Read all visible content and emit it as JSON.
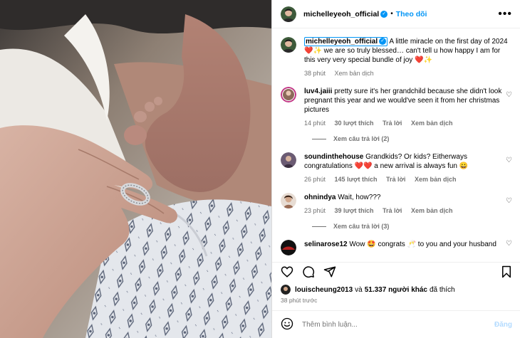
{
  "colors": {
    "accent": "#0095f6",
    "heart": "#ed4956",
    "muted": "#737373"
  },
  "header": {
    "username": "michelleyeoh_official",
    "follow_label": "Theo dõi",
    "more_icon": "more-horizontal-icon"
  },
  "caption": {
    "username": "michelleyeoh_official",
    "text": "A little miracle on the first day of 2024 ❤️✨ we are so truly blessed… can't tell u how happy I am for this very very special bundle of joy ❤️✨",
    "time": "38 phút",
    "translate": "Xem bản dịch"
  },
  "comments": [
    {
      "username": "luv4.jaiii",
      "text": "pretty sure it's her grandchild because she didn't look pregnant this year and we would've seen it from her christmas pictures",
      "time": "14 phút",
      "likes": "30 lượt thích",
      "reply": "Trả lời",
      "translate": "Xem bản dịch",
      "view_replies": "Xem câu trả lời (2)"
    },
    {
      "username": "soundinthehouse",
      "text": "Grandkids? Or kids? Eitherways congratulations ❤️❤️ a new arrival is always fun 😀",
      "time": "26 phút",
      "likes": "145 lượt thích",
      "reply": "Trả lời",
      "translate": "Xem bản dịch"
    },
    {
      "username": "ohnindya",
      "text": "Wait, how???",
      "time": "23 phút",
      "likes": "39 lượt thích",
      "reply": "Trả lời",
      "translate": "Xem bản dịch",
      "view_replies": "Xem câu trả lời (3)"
    },
    {
      "username": "selinarose12",
      "text": "Wow 🤩 congrats 🥂 to you and your husband"
    }
  ],
  "likes": {
    "user": "louischeung2013",
    "and": "và",
    "others": "51.337 người khác",
    "liked": "đã thích"
  },
  "posted_ago": "38 phút trước",
  "comment_box": {
    "placeholder": "Thêm bình luận...",
    "post_label": "Đăng"
  }
}
